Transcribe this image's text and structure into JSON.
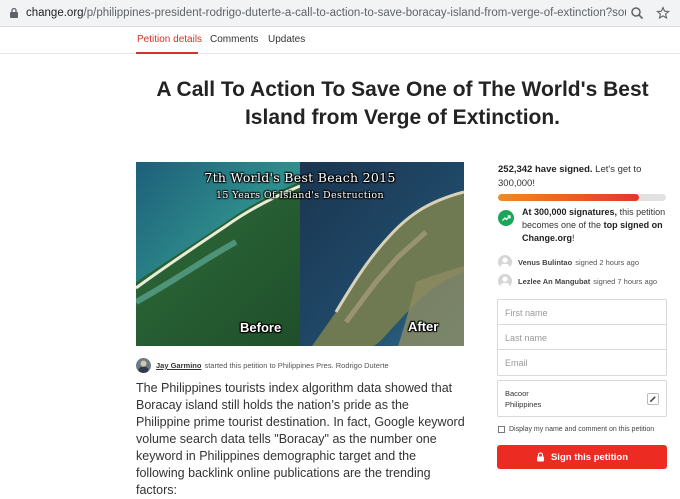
{
  "browser": {
    "domain": "change.org",
    "path": "/p/philippines-president-rodrigo-duterte-a-call-to-action-to-save-boracay-island-from-verge-of-extinction?source_location...",
    "icons": [
      "lock-icon",
      "zoom-icon",
      "star-icon"
    ]
  },
  "tabs": [
    {
      "label": "Petition details",
      "active": true
    },
    {
      "label": "Comments",
      "active": false
    },
    {
      "label": "Updates",
      "active": false
    }
  ],
  "petition": {
    "title_line1": "A Call To Action To Save One of The World's Best",
    "title_line2": "Island from Verge of Extinction.",
    "image": {
      "title": "7th World's Best Beach 2015",
      "subtitle": "15 Years Of Island's Destruction",
      "before": "Before",
      "after": "After"
    },
    "starter_name": "Jay Garmino",
    "starter_text": "started this petition to Philippines Pres. Rodrigo Duterte",
    "body": "The Philippines tourists index algorithm data showed that Boracay island still holds the nation’s pride as the Philippine prime tourist destination. In fact, Google keyword volume search data tells \"Boracay\" as the number one keyword in Philippines demographic target and the following backlink online publications are the trending factors:"
  },
  "sidebar": {
    "signed_count": "252,342 have signed.",
    "signed_rest": "Let's get to 300,000!",
    "progress_fraction": 0.84,
    "accent": "#ec2c22",
    "goal_bold": "At 300,000 signatures,",
    "goal_text": "this petition becomes one of the",
    "goal_bold2": "top signed on Change.org",
    "goal_end": "!",
    "signers": [
      {
        "name": "Venus Bulintao",
        "time": "signed 2 hours ago"
      },
      {
        "name": "Lezlee An Mangubat",
        "time": "signed 7 hours ago"
      }
    ],
    "form": {
      "first_name": "First name",
      "last_name": "Last name",
      "email": "Email",
      "city": "Bacoor",
      "country": "Philippines"
    },
    "display_label": "Display my name and comment on this petition",
    "sign_button": "Sign this petition"
  }
}
